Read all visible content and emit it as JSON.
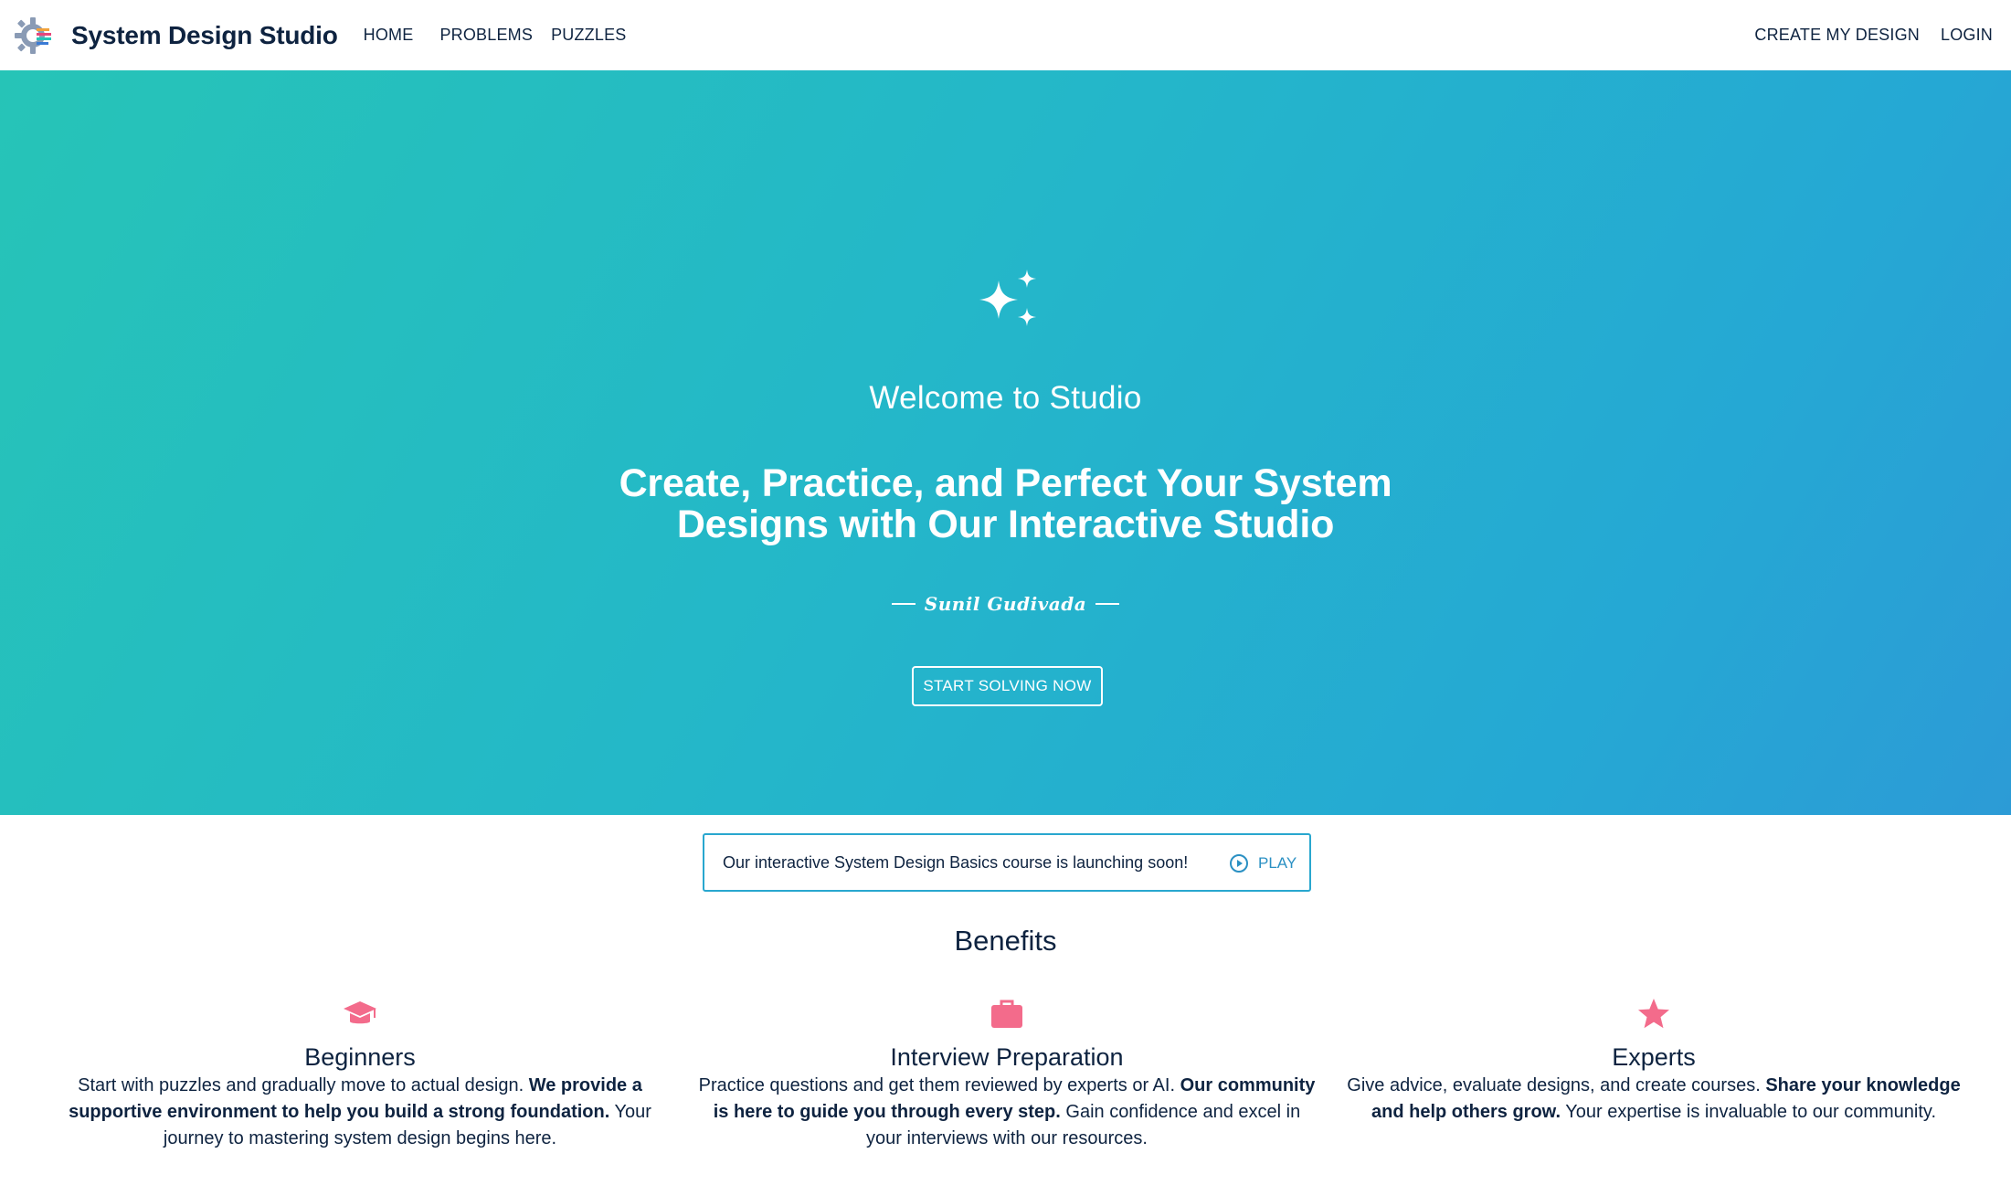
{
  "header": {
    "brand": "System Design Studio",
    "nav": [
      "HOME",
      "PROBLEMS",
      "PUZZLES"
    ],
    "actions": [
      "CREATE MY DESIGN",
      "LOGIN"
    ]
  },
  "hero": {
    "welcome": "Welcome to Studio",
    "tagline_line1": "Create, Practice, and Perfect Your System",
    "tagline_line2": "Designs with Our Interactive Studio",
    "signature": "Sunil Gudivada",
    "cta_label": "START SOLVING NOW",
    "gradient_start": "#26c4b7",
    "gradient_end": "#2c9bd6"
  },
  "announcement": {
    "text": "Our interactive System Design Basics course is launching soon!",
    "play_label": "PLAY"
  },
  "benefits": {
    "title": "Benefits",
    "accent_color": "#f36b8b",
    "items": [
      {
        "icon": "graduation-cap-icon",
        "title": "Beginners",
        "text_a": "Start with puzzles and gradually move to actual design. ",
        "text_b": "We provide a supportive environment to help you build a strong foundation.",
        "text_c": " Your journey to mastering system design begins here."
      },
      {
        "icon": "briefcase-icon",
        "title": "Interview Preparation",
        "text_a": "Practice questions and get them reviewed by experts or AI. ",
        "text_b": "Our community is here to guide you through every step.",
        "text_c": " Gain confidence and excel in your interviews with our resources."
      },
      {
        "icon": "star-icon",
        "title": "Experts",
        "text_a": "Give advice, evaluate designs, and create courses. ",
        "text_b": "Share your knowledge and help others grow.",
        "text_c": " Your expertise is invaluable to our community."
      }
    ]
  }
}
